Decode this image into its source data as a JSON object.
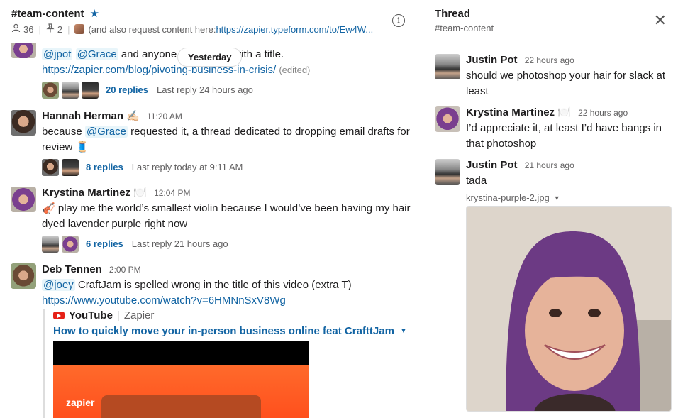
{
  "channel": {
    "name": "#team-content",
    "members": "36",
    "pins": "2",
    "topic_prefix": "(and also request content here: ",
    "topic_link": "https://zapier.typeform.com/to/Ew4W...",
    "info_icon": "info-icon"
  },
  "divider": {
    "label": "Yesterday"
  },
  "messages": [
    {
      "text_before": "and anyone e",
      "text_after": "p with a title.",
      "mention1": "@jpot",
      "mention2": "@Grace",
      "link": "https://zapier.com/blog/pivoting-business-in-crisis/",
      "edited": "(edited)",
      "reply_count": "20 replies",
      "last_reply": "Last reply 24 hours ago"
    },
    {
      "sender": "Hannah Herman",
      "status_emoji": "✍🏻",
      "time": "11:20 AM",
      "text_before": "because ",
      "mention": "@Grace",
      "text_after": " requested it, a thread dedicated to dropping email drafts for review 🧵",
      "reply_count": "8 replies",
      "last_reply": "Last reply today at 9:11 AM"
    },
    {
      "sender": "Krystina Martinez",
      "status_emoji": "🍽️",
      "time": "12:04 PM",
      "emoji": "🎻",
      "text": " play me the world’s smallest violin because I would’ve been having my hair dyed lavender purple right now",
      "reply_count": "6 replies",
      "last_reply": "Last reply 21 hours ago"
    },
    {
      "sender": "Deb Tennen",
      "time": "2:00 PM",
      "mention": "@joey",
      "text": " CraftJam is spelled wrong in the title of this video (extra T)",
      "link": "https://www.youtube.com/watch?v=6HMNnSxV8Wg",
      "attachment": {
        "source": "YouTube",
        "author": "Zapier",
        "title": "How to quickly move your in-person business online feat CrafttJam",
        "video_brand": "zapier"
      }
    }
  ],
  "thread": {
    "title": "Thread",
    "channel": "#team-content",
    "messages": [
      {
        "sender": "Justin Pot",
        "time": "22 hours ago",
        "text": "should we photoshop your hair for slack at least"
      },
      {
        "sender": "Krystina Martinez",
        "status_emoji": "🍽️",
        "time": "22 hours ago",
        "text": "I’d appreciate it, at least I’d have bangs in that photoshop"
      },
      {
        "sender": "Justin Pot",
        "time": "21 hours ago",
        "text": "tada",
        "file_name": "krystina-purple-2.jpg"
      }
    ]
  },
  "colors": {
    "link": "#1264a3",
    "mention_bg": "#e8f5fa",
    "border": "#dddddd"
  }
}
